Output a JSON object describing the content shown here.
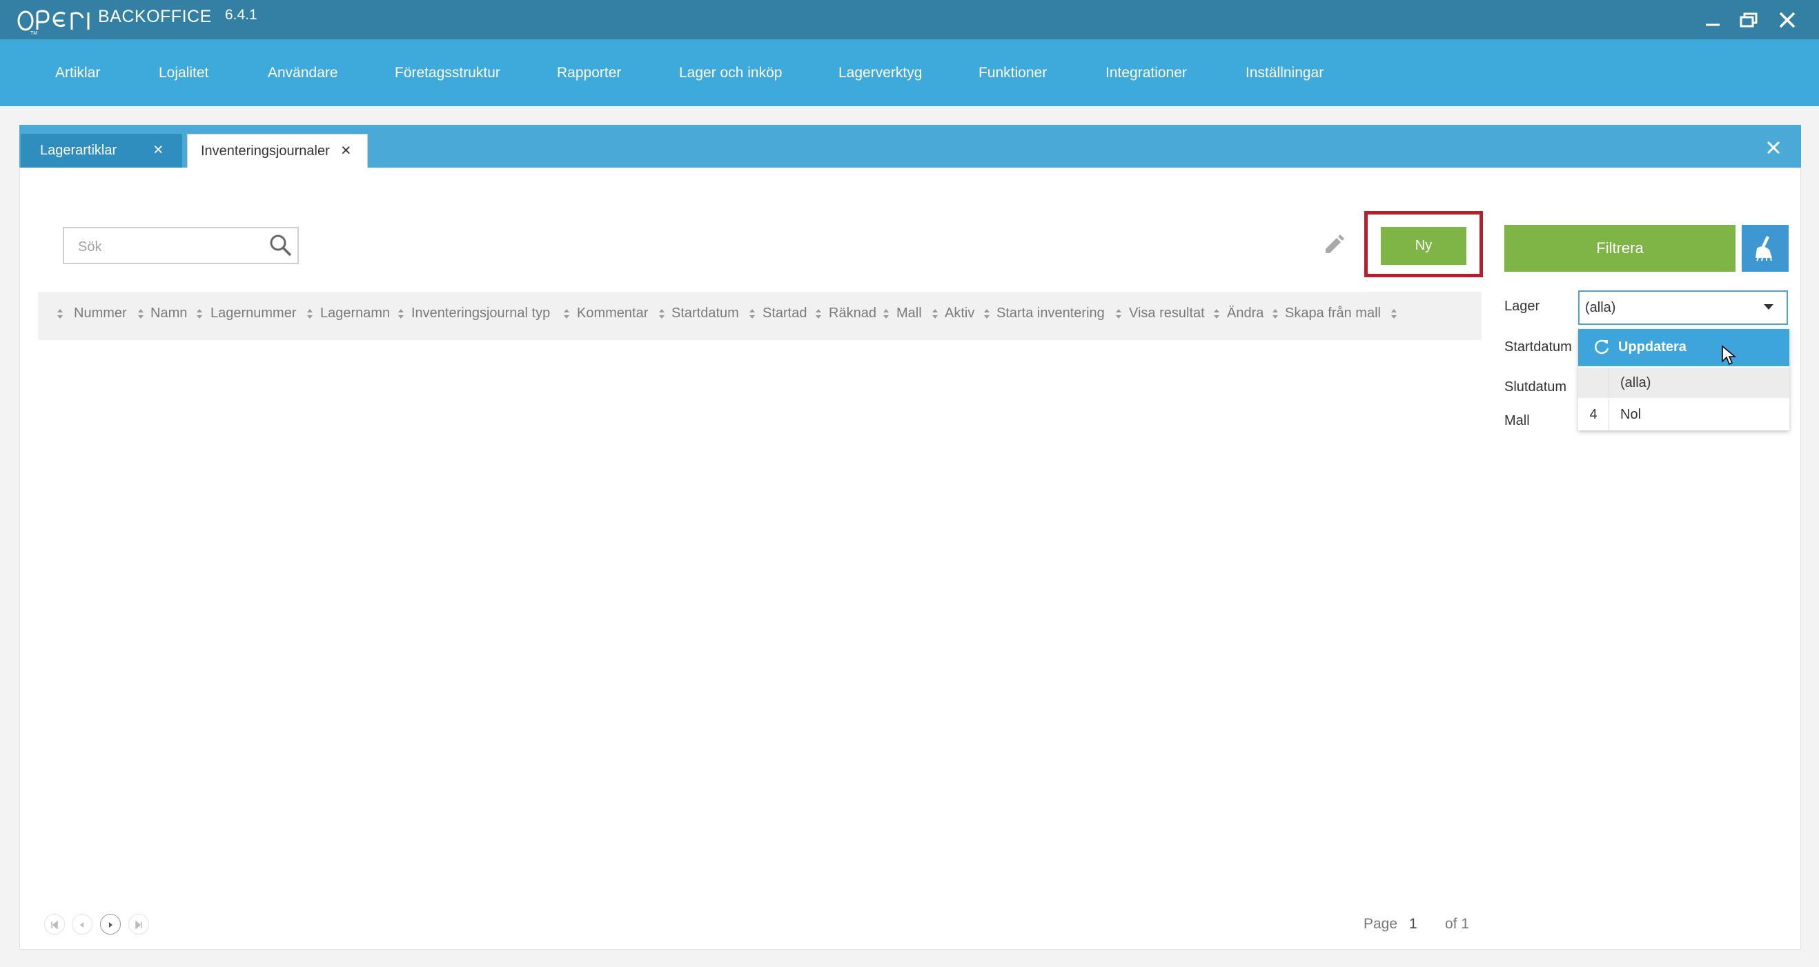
{
  "app": {
    "name": "BACKOFFICE",
    "version": "6.4.1"
  },
  "window_controls": [
    "minimize-icon",
    "restore-icon",
    "close-icon"
  ],
  "nav": {
    "items": [
      "Artiklar",
      "Lojalitet",
      "Användare",
      "Företagsstruktur",
      "Rapporter",
      "Lager och inköp",
      "Lagerverktyg",
      "Funktioner",
      "Integrationer",
      "Inställningar"
    ]
  },
  "tabs": [
    {
      "label": "Lagerartiklar",
      "active": false
    },
    {
      "label": "Inventeringsjournaler",
      "active": true
    }
  ],
  "toolbar": {
    "search_placeholder": "Sök",
    "new_label": "Ny"
  },
  "table": {
    "columns": [
      "Nummer",
      "Namn",
      "Lagernummer",
      "Lagernamn",
      "Inventeringsjournal typ",
      "Kommentar",
      "Startdatum",
      "Startad",
      "Räknad",
      "Mall",
      "Aktiv",
      "Starta inventering",
      "Visa resultat",
      "Ändra",
      "Skapa från mall"
    ],
    "rows": []
  },
  "filter": {
    "button_label": "Filtrera",
    "labels": {
      "lager": "Lager",
      "startdatum": "Startdatum",
      "slutdatum": "Slutdatum",
      "mall": "Mall"
    },
    "lager_value": "(alla)",
    "dropdown": {
      "refresh_label": "Uppdatera",
      "options": [
        {
          "num": "",
          "name": "(alla)"
        },
        {
          "num": "4",
          "name": "Nol"
        }
      ]
    }
  },
  "pager": {
    "page_label": "Page",
    "page": "1",
    "of_label": "of 1"
  },
  "colors": {
    "titlebar": "#347fa4",
    "nav": "#3eaadb",
    "accent_green": "#7fb447",
    "highlight_red": "#b5202a"
  }
}
